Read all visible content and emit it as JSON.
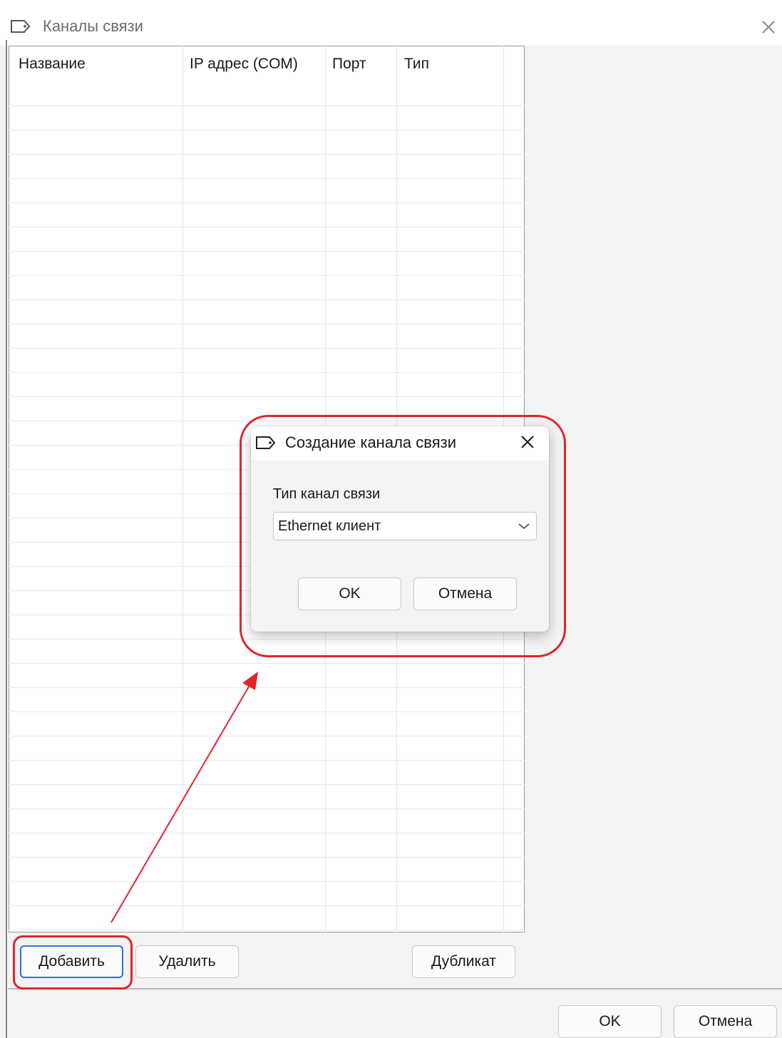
{
  "window": {
    "title": "Каналы связи"
  },
  "table": {
    "columns": [
      "Название",
      "IP адрес (COM)",
      "Порт",
      "Тип"
    ]
  },
  "toolbar": {
    "add_label": "Добавить",
    "delete_label": "Удалить",
    "duplicate_label": "Дубликат"
  },
  "footer": {
    "ok_label": "OK",
    "cancel_label": "Отмена"
  },
  "dialog": {
    "title": "Создание канала связи",
    "field_label": "Тип канал связи",
    "select_value": "Ethernet клиент",
    "ok_label": "OK",
    "cancel_label": "Отмена"
  },
  "colors": {
    "highlight": "#e1252b",
    "focus": "#2f73d3"
  }
}
